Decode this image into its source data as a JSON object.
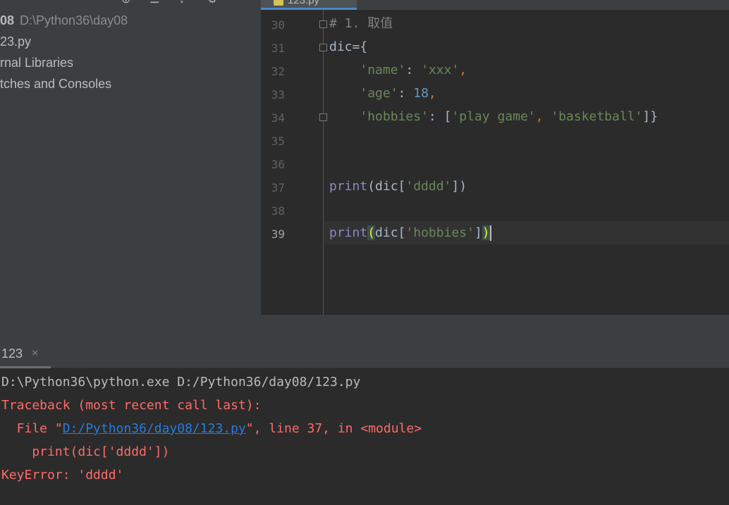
{
  "project": {
    "root_name": "08",
    "root_path": "D:\\Python36\\day08",
    "items": [
      "23.py",
      "rnal Libraries",
      "tches and Consoles"
    ]
  },
  "editor": {
    "tab_label": "123.py",
    "gutter": [
      "30",
      "31",
      "32",
      "33",
      "34",
      "35",
      "36",
      "37",
      "38",
      "39"
    ],
    "current_line": "39"
  },
  "code": {
    "l30_comment": "# 1. 取值",
    "l31_name": "dic",
    "l31_assign": "={",
    "l32_key": "'name'",
    "l32_colon": ": ",
    "l32_value": "'xxx'",
    "l32_comma": ",",
    "l33_key": "'age'",
    "l33_colon": ": ",
    "l33_value": "18",
    "l33_comma": ",",
    "l34_key": "'hobbies'",
    "l34_colon": ": [",
    "l34_item1": "'play game'",
    "l34_sep": ", ",
    "l34_item2": "'basketball'",
    "l34_close": "]}",
    "l37_builtin": "print",
    "l37_open": "(dic[",
    "l37_key": "'dddd'",
    "l37_close": "])",
    "l39_builtin": "print",
    "l39_paren_open": "(",
    "l39_mid": "dic[",
    "l39_key": "'hobbies'",
    "l39_bracket": "]",
    "l39_paren_close": ")"
  },
  "run": {
    "tab_label": "123",
    "close_glyph": "×"
  },
  "console": {
    "cmd": "D:\\Python36\\python.exe D:/Python36/day08/123.py",
    "traceback": "Traceback (most recent call last):",
    "file_prefix": "  File \"",
    "file_link": "D:/Python36/day08/123.py",
    "file_suffix": "\", line 37, in <module>",
    "code_line": "    print(dic['dddd'])",
    "error": "KeyError: 'dddd'"
  },
  "colors": {
    "editor_bg": "#2b2b2b",
    "panel_bg": "#3c3f41",
    "string": "#6a8759",
    "number": "#6897bb",
    "comment": "#808080",
    "builtin": "#8888c6",
    "keyword_op": "#cc7832",
    "error_text": "#ff6b68",
    "link": "#287bde",
    "tab_underline": "#4a88c7"
  }
}
